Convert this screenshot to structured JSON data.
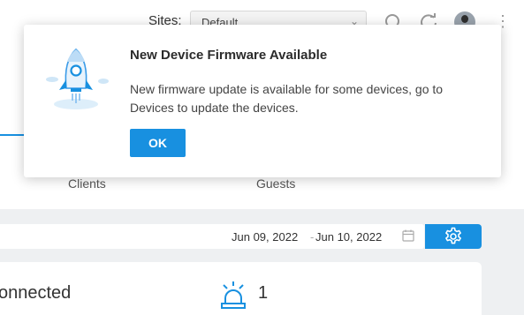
{
  "header": {
    "sites_label": "Sites:",
    "site_selected": "Default",
    "icons": [
      "search-icon",
      "refresh-icon",
      "user-avatar",
      "more-icon"
    ]
  },
  "stats": {
    "clients_label": "Clients",
    "guests_label": "Guests"
  },
  "date_range": {
    "start": "Jun 09, 2022",
    "separator": "-",
    "end": "Jun 10, 2022"
  },
  "summary": {
    "status_text": "onnected",
    "alert_count": "1"
  },
  "popup": {
    "title": "New Device Firmware Available",
    "message": "New firmware update is available for some devices, go to Devices to update the devices.",
    "ok_label": "OK"
  },
  "colors": {
    "accent": "#1890e0",
    "background": "#eef0f2"
  }
}
